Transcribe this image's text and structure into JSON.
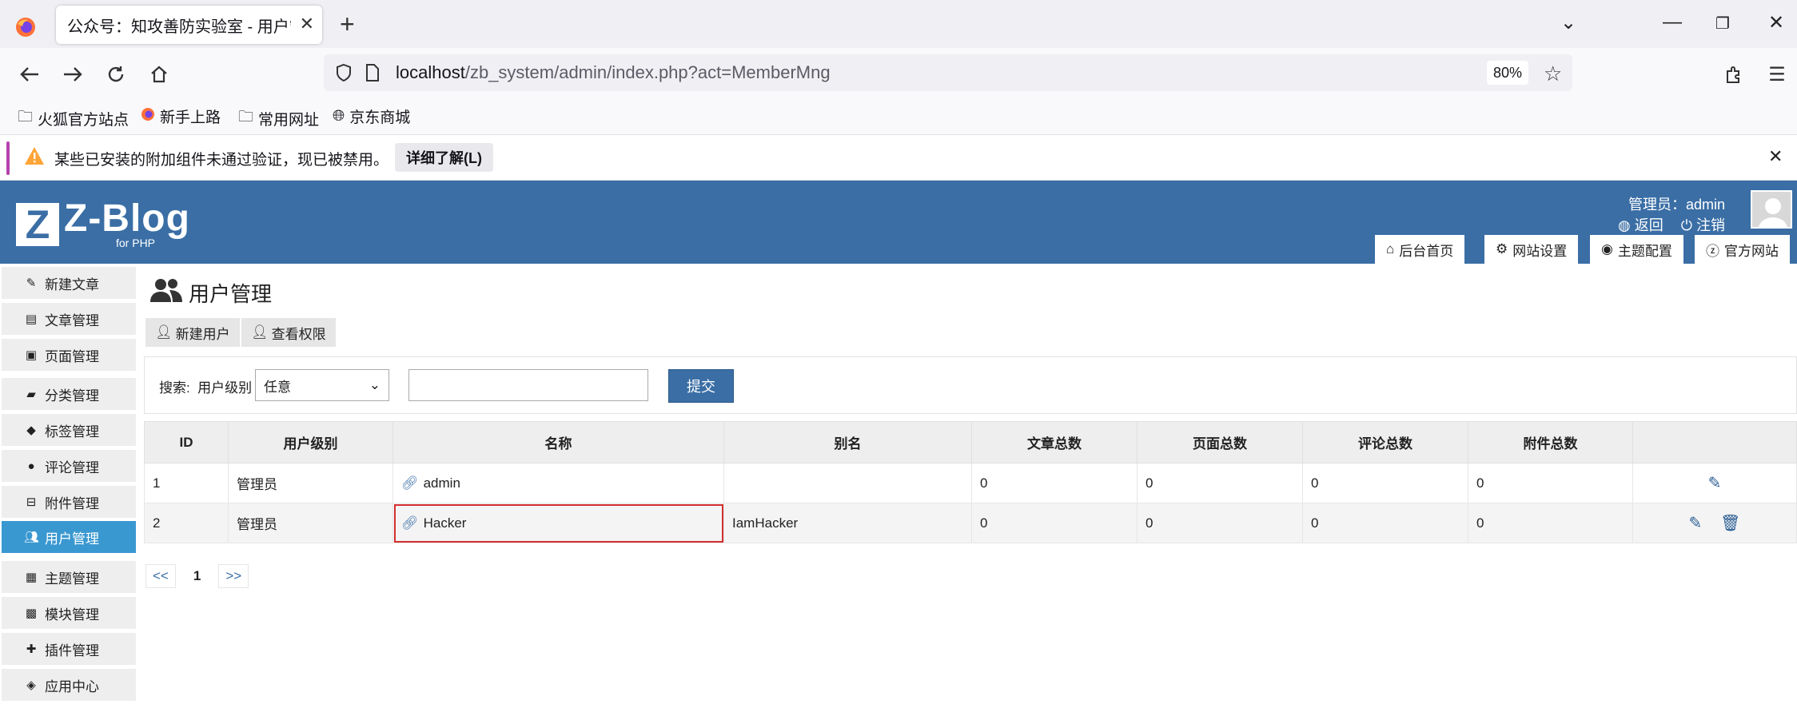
{
  "browser": {
    "tab_title": "公众号：知攻善防实验室 - 用户管理",
    "url_host": "localhost",
    "url_path": "/zb_system/admin/index.php?act=MemberMng",
    "zoom": "80%",
    "bookmarks": [
      "火狐官方站点",
      "新手上路",
      "常用网址",
      "京东商城"
    ],
    "notice_text": "某些已安装的附加组件未通过验证，现已被禁用。",
    "notice_button": "详细了解(L)"
  },
  "header": {
    "logo_mark": "Z",
    "logo_text": "Z-Blog",
    "logo_sub": "for PHP",
    "admin_label": "管理员：admin",
    "back_link": "返回",
    "logout_link": "注销",
    "tabs": [
      "后台首页",
      "网站设置",
      "主题配置",
      "官方网站"
    ]
  },
  "sidebar": {
    "items": [
      "新建文章",
      "文章管理",
      "页面管理",
      "分类管理",
      "标签管理",
      "评论管理",
      "附件管理",
      "用户管理",
      "主题管理",
      "模块管理",
      "插件管理",
      "应用中心"
    ],
    "active": "用户管理"
  },
  "main": {
    "title": "用户管理",
    "buttons": [
      "新建用户",
      "查看权限"
    ],
    "search": {
      "label": "搜索:  用户级别",
      "select_value": "任意",
      "input_value": "",
      "submit": "提交"
    },
    "table": {
      "headers": [
        "ID",
        "用户级别",
        "名称",
        "别名",
        "文章总数",
        "页面总数",
        "评论总数",
        "附件总数",
        ""
      ],
      "rows": [
        {
          "id": "1",
          "level": "管理员",
          "name": "admin",
          "alias": "",
          "articles": "0",
          "pages": "0",
          "comments": "0",
          "attachments": "0"
        },
        {
          "id": "2",
          "level": "管理员",
          "name": "Hacker",
          "alias": "IamHacker",
          "articles": "0",
          "pages": "0",
          "comments": "0",
          "attachments": "0"
        }
      ]
    },
    "pager": {
      "prev": "<<",
      "current": "1",
      "next": ">>"
    }
  }
}
